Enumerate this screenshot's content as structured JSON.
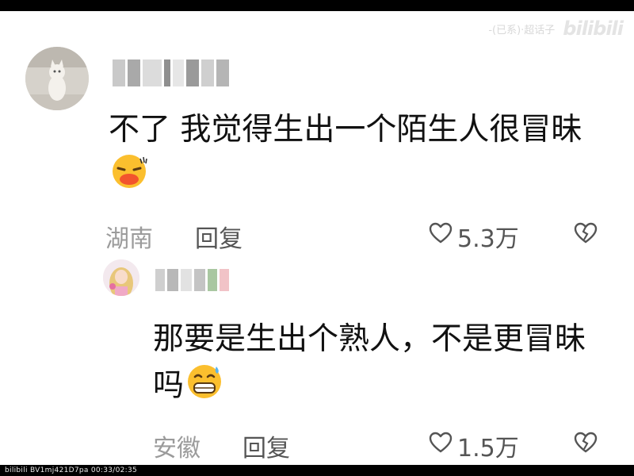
{
  "watermark": {
    "text": "-(已系)·超话子",
    "logo": "bilibili"
  },
  "footer": {
    "text": "bilibili BV1mj421D7pa 00:33/02:35"
  },
  "comments": [
    {
      "text": "不了 我觉得生出一个陌生人很冒昧",
      "emoji": "squinting-kiss-emoji",
      "location": "湖南",
      "reply_label": "回复",
      "likes": "5.3万"
    },
    {
      "text": "那要是生出个熟人，不是更冒昧吗",
      "emoji": "grinning-sweat-emoji",
      "location": "安徽",
      "reply_label": "回复",
      "likes": "1.5万"
    }
  ],
  "colors": {
    "text": "#111111",
    "meta_gray": "#9b9b9b",
    "icon_gray": "#555555",
    "bg": "#ffffff"
  }
}
